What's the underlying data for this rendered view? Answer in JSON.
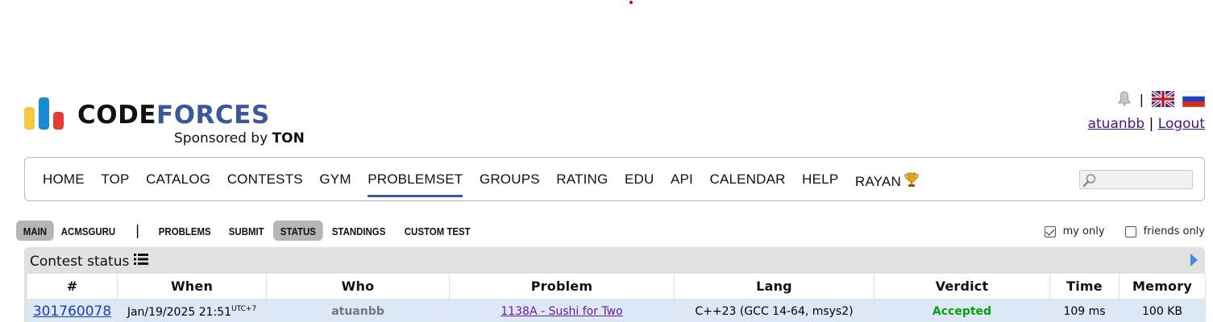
{
  "header": {
    "logo_word_code": "CODE",
    "logo_word_forces": "FORCES",
    "sponsored_by": "Sponsored by",
    "sponsor": "TON",
    "separator": "|",
    "username": "atuanbb",
    "links_separator": "|",
    "logout": "Logout"
  },
  "menu": {
    "items": [
      "HOME",
      "TOP",
      "CATALOG",
      "CONTESTS",
      "GYM",
      "PROBLEMSET",
      "GROUPS",
      "RATING",
      "EDU",
      "API",
      "CALENDAR",
      "HELP",
      "RAYAN"
    ],
    "active": "PROBLEMSET",
    "search_value": ""
  },
  "submenu": {
    "items": [
      "MAIN",
      "ACMSGURU",
      "PROBLEMS",
      "SUBMIT",
      "STATUS",
      "STANDINGS",
      "CUSTOM TEST"
    ],
    "selected": [
      "MAIN",
      "STATUS"
    ],
    "separator": "|"
  },
  "filters": {
    "my_only": {
      "label": "my only",
      "checked": true
    },
    "friends_only": {
      "label": "friends only",
      "checked": false
    }
  },
  "status": {
    "title": "Contest status",
    "columns": [
      "#",
      "When",
      "Who",
      "Problem",
      "Lang",
      "Verdict",
      "Time",
      "Memory"
    ],
    "rows": [
      {
        "id": "301760078",
        "when": "Jan/19/2025 21:51",
        "tz": "UTC+7",
        "who": "atuanbb",
        "problem": "1138A - Sushi for Two",
        "lang": "C++23 (GCC 14-64, msys2)",
        "verdict": "Accepted",
        "time": "109 ms",
        "memory": "100 KB"
      }
    ]
  },
  "colors": {
    "accent": "#3b5998",
    "accepted": "#0a9e0a",
    "row_bg": "#dce8f6",
    "link": "#1a3fae"
  }
}
